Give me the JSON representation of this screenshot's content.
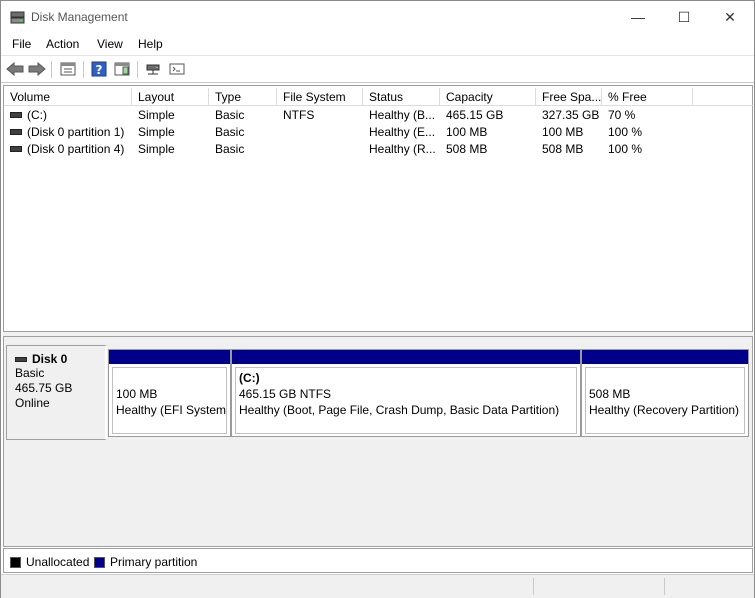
{
  "window": {
    "title": "Disk Management",
    "minimize": "—",
    "maximize": "☐",
    "close": "✕"
  },
  "menu": [
    "File",
    "Action",
    "View",
    "Help"
  ],
  "toolbar_icons": [
    "back-icon",
    "forward-icon",
    "properties-icon",
    "help-icon",
    "show-hide-pane-icon",
    "connect-disk-icon",
    "console-icon"
  ],
  "volume_table": {
    "headers": [
      "Volume",
      "Layout",
      "Type",
      "File System",
      "Status",
      "Capacity",
      "Free Spa...",
      "% Free"
    ],
    "rows": [
      [
        "(C:)",
        "Simple",
        "Basic",
        "NTFS",
        "Healthy (B...",
        "465.15 GB",
        "327.35 GB",
        "70 %"
      ],
      [
        "(Disk 0 partition 1)",
        "Simple",
        "Basic",
        "",
        "Healthy (E...",
        "100 MB",
        "100 MB",
        "100 %"
      ],
      [
        "(Disk 0 partition 4)",
        "Simple",
        "Basic",
        "",
        "Healthy (R...",
        "508 MB",
        "508 MB",
        "100 %"
      ]
    ]
  },
  "disk": {
    "name": "Disk 0",
    "type": "Basic",
    "size": "465.75 GB",
    "state": "Online",
    "partitions": [
      {
        "name": "",
        "size": "100 MB",
        "status": "Healthy (EFI System"
      },
      {
        "name": "(C:)",
        "size": "465.15 GB NTFS",
        "status": "Healthy (Boot, Page File, Crash Dump, Basic Data Partition)"
      },
      {
        "name": "",
        "size": "508 MB",
        "status": "Healthy (Recovery Partition)"
      }
    ]
  },
  "legend": [
    {
      "label": "Unallocated",
      "color": "#000000"
    },
    {
      "label": "Primary partition",
      "color": "#00008b"
    }
  ],
  "colors": {
    "partition_bar": "#00008b"
  }
}
